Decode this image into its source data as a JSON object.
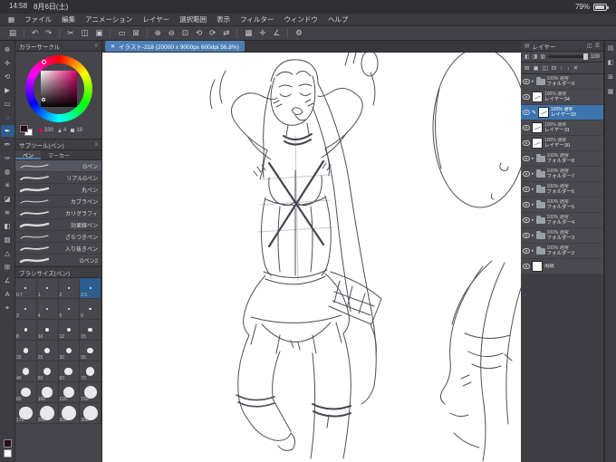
{
  "status_bar": {
    "time": "14:58",
    "date": "8月6日(土)",
    "battery": "79%"
  },
  "menu_bar": {
    "app_menu_glyph": "▦",
    "items": [
      "ファイル",
      "編集",
      "アニメーション",
      "レイヤー",
      "選択範囲",
      "表示",
      "フィルター",
      "ウィンドウ",
      "ヘルプ"
    ]
  },
  "toolbar": {
    "icons": [
      {
        "name": "panels-icon",
        "glyph": "▤"
      },
      {
        "sep": true
      },
      {
        "name": "undo-icon",
        "glyph": "↶"
      },
      {
        "name": "redo-icon",
        "glyph": "↷"
      },
      {
        "sep": true
      },
      {
        "name": "cut-icon",
        "glyph": "✂"
      },
      {
        "name": "copy-icon",
        "glyph": "◫"
      },
      {
        "name": "paste-icon",
        "glyph": "▣"
      },
      {
        "sep": true
      },
      {
        "name": "select-icon",
        "glyph": "▭"
      },
      {
        "name": "deselect-icon",
        "glyph": "⊠"
      },
      {
        "sep": true
      },
      {
        "name": "zoom-in-icon",
        "glyph": "⊕"
      },
      {
        "name": "zoom-out-icon",
        "glyph": "⊖"
      },
      {
        "name": "fit-screen-icon",
        "glyph": "⊡"
      },
      {
        "name": "rotate-left-icon",
        "glyph": "⟲"
      },
      {
        "name": "rotate-right-icon",
        "glyph": "⟳"
      },
      {
        "name": "flip-horizontal-icon",
        "glyph": "⇄"
      },
      {
        "sep": true
      },
      {
        "name": "grid-icon",
        "glyph": "▦"
      },
      {
        "name": "snap-icon",
        "glyph": "✛"
      },
      {
        "name": "ruler-icon",
        "glyph": "∠"
      },
      {
        "sep": true
      },
      {
        "name": "settings-icon",
        "glyph": "⚙"
      }
    ]
  },
  "tool_strip": {
    "tools": [
      {
        "name": "zoom-tool-icon",
        "glyph": "⊕"
      },
      {
        "name": "hand-tool-icon",
        "glyph": "✛"
      },
      {
        "name": "rotate-canvas-tool-icon",
        "glyph": "⟲"
      },
      {
        "name": "object-tool-icon",
        "glyph": "▶"
      },
      {
        "name": "selection-tool-icon",
        "glyph": "▭"
      },
      {
        "name": "lasso-tool-icon",
        "glyph": "◌"
      },
      {
        "name": "pen-tool-icon",
        "glyph": "✒",
        "selected": true
      },
      {
        "name": "pencil-tool-icon",
        "glyph": "✏"
      },
      {
        "name": "brush-tool-icon",
        "glyph": "✑"
      },
      {
        "name": "airbrush-tool-icon",
        "glyph": "◍"
      },
      {
        "name": "decoration-tool-icon",
        "glyph": "✳"
      },
      {
        "name": "eraser-tool-icon",
        "glyph": "◪"
      },
      {
        "name": "blend-tool-icon",
        "glyph": "≋"
      },
      {
        "name": "fill-tool-icon",
        "glyph": "◧"
      },
      {
        "name": "gradient-tool-icon",
        "glyph": "▨"
      },
      {
        "name": "figure-tool-icon",
        "glyph": "△"
      },
      {
        "name": "frame-tool-icon",
        "glyph": "⊞"
      },
      {
        "name": "ruler-tool-icon",
        "glyph": "∠"
      },
      {
        "name": "text-tool-icon",
        "glyph": "A"
      },
      {
        "name": "eyedropper-tool-icon",
        "glyph": "⌖"
      }
    ]
  },
  "color_panel": {
    "title": "カラーサークル",
    "panel_menu_glyph": "≡",
    "hue": "330",
    "sat": "4",
    "val": "18"
  },
  "subtool_panel": {
    "title": "サブツール(ペン)",
    "panel_menu_glyph": "≡",
    "tabs": [
      {
        "label": "ペン",
        "selected": true
      },
      {
        "label": "マーカー",
        "selected": false
      }
    ],
    "items": [
      {
        "label": "Gペン",
        "selected": true
      },
      {
        "label": "リアルGペン"
      },
      {
        "label": "丸ペン"
      },
      {
        "label": "カブラペン"
      },
      {
        "label": "カリグラフィ"
      },
      {
        "label": "効果線ペン"
      },
      {
        "label": "ざらつきペン"
      },
      {
        "label": "入り抜きペン"
      },
      {
        "label": "Gペン2"
      }
    ]
  },
  "brush_panel": {
    "title": "ブラシサイズ(ペン)",
    "selected": "2.5",
    "sizes": [
      "0.7",
      "1",
      "2",
      "2.5",
      "3",
      "4",
      "5",
      "6",
      "8",
      "10",
      "12",
      "15",
      "20",
      "25",
      "30",
      "35",
      "40",
      "50",
      "60",
      "70",
      "80",
      "100",
      "120",
      "150",
      "170",
      "200",
      "250",
      "300"
    ]
  },
  "canvas": {
    "tab_label": "イラスト-218 (20000 x 9000px 600dpi 56.8%)",
    "close_glyph": "✕"
  },
  "layer_panel": {
    "title": "レイヤー",
    "tab_glyph": "▤",
    "opacity": "100",
    "glyphs": {
      "folder_arrow": "▸",
      "pencil": "✎"
    },
    "header_icons": [
      {
        "name": "layer-search-icon",
        "glyph": "◫"
      },
      {
        "name": "layer-panel-menu-icon",
        "glyph": "☰"
      }
    ],
    "mode_icons": [
      {
        "name": "blend-mode-icon",
        "glyph": "◧"
      },
      {
        "name": "clip-mask-icon",
        "glyph": "◨"
      },
      {
        "name": "lock-icon",
        "glyph": "▥"
      }
    ],
    "action_icons": [
      {
        "name": "new-layer-icon",
        "glyph": "⊞"
      },
      {
        "name": "new-folder-icon",
        "glyph": "▣"
      },
      {
        "name": "duplicate-layer-icon",
        "glyph": "◫"
      },
      {
        "name": "merge-down-icon",
        "glyph": "⊟"
      },
      {
        "name": "move-up-icon",
        "glyph": "↑"
      },
      {
        "name": "move-down-icon",
        "glyph": "↓"
      },
      {
        "name": "delete-layer-icon",
        "glyph": "✕"
      }
    ],
    "items": [
      {
        "type": "folder",
        "opacity": "100%",
        "blend": "通常",
        "name": "フォルダー9"
      },
      {
        "type": "layer",
        "opacity": "100%",
        "blend": "通常",
        "name": "レイヤー34"
      },
      {
        "type": "layer",
        "opacity": "100%",
        "blend": "通常",
        "name": "レイヤー33",
        "selected": true,
        "editing": true
      },
      {
        "type": "layer",
        "opacity": "100%",
        "blend": "通常",
        "name": "レイヤー31"
      },
      {
        "type": "layer",
        "opacity": "100%",
        "blend": "通常",
        "name": "レイヤー30"
      },
      {
        "type": "folder",
        "opacity": "100%",
        "blend": "通常",
        "name": "フォルダー8"
      },
      {
        "type": "folder",
        "opacity": "100%",
        "blend": "通常",
        "name": "フォルダー7"
      },
      {
        "type": "folder",
        "opacity": "100%",
        "blend": "通常",
        "name": "フォルダー6"
      },
      {
        "type": "folder",
        "opacity": "100%",
        "blend": "通常",
        "name": "フォルダー5"
      },
      {
        "type": "folder",
        "opacity": "100%",
        "blend": "通常",
        "name": "フォルダー4"
      },
      {
        "type": "folder",
        "opacity": "100%",
        "blend": "通常",
        "name": "フォルダー3"
      },
      {
        "type": "folder",
        "opacity": "100%",
        "blend": "通常",
        "name": "フォルダー2"
      },
      {
        "type": "paper",
        "name": "用紙"
      }
    ]
  },
  "right_strip": {
    "icons": [
      {
        "name": "layer-tab-icon",
        "glyph": "▤"
      },
      {
        "name": "layer-property-tab-icon",
        "glyph": "◧"
      },
      {
        "name": "navigator-tab-icon",
        "glyph": "⊞"
      },
      {
        "name": "material-tab-icon",
        "glyph": "▦"
      }
    ]
  }
}
